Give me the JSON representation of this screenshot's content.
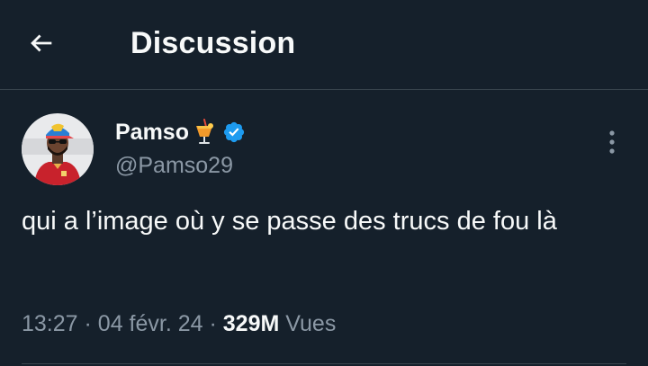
{
  "header": {
    "title": "Discussion",
    "back_icon": "arrow-left-icon"
  },
  "tweet": {
    "author": {
      "display_name": "Pamso",
      "name_emoji": "tropical-drink-icon",
      "verified_icon": "verified-badge-icon",
      "handle": "@Pamso29"
    },
    "text": "qui a l’image où y se passe des trucs de fou là",
    "timestamp_time": "13:27",
    "timestamp_date": "04 févr. 24",
    "separator": "·",
    "views_count": "329M",
    "views_label": "Vues"
  },
  "colors": {
    "background": "#15202b",
    "text_primary": "#f7f9f9",
    "text_secondary": "#8b98a5",
    "border": "#38444d",
    "verified": "#1d9bf0"
  }
}
